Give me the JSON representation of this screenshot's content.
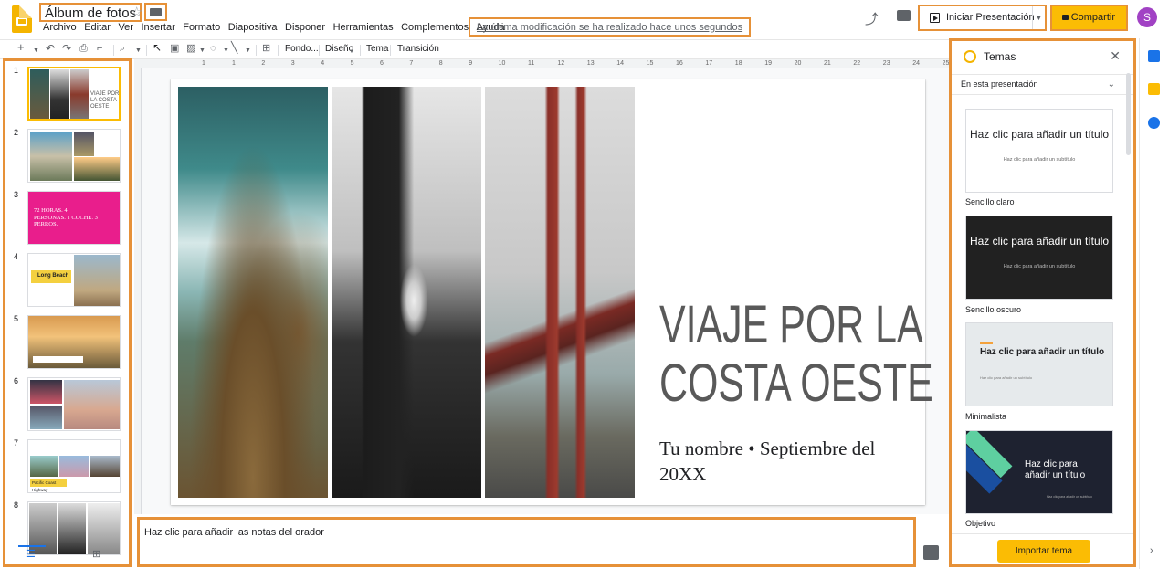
{
  "app": {
    "doc_title": "Álbum de fotos",
    "menus": [
      "Archivo",
      "Editar",
      "Ver",
      "Insertar",
      "Formato",
      "Diapositiva",
      "Disponer",
      "Herramientas",
      "Complementos",
      "Ayuda"
    ],
    "last_modified": "La última modificación se ha realizado hace unos segundos",
    "present_label": "Iniciar Presentación",
    "share_label": "Compartir",
    "avatar_letter": "S"
  },
  "toolbar": {
    "background": "Fondo...",
    "layout": "Diseño",
    "theme": "Tema",
    "transition": "Transición"
  },
  "ruler": [
    "1",
    "1",
    "2",
    "3",
    "4",
    "5",
    "6",
    "7",
    "8",
    "9",
    "10",
    "11",
    "12",
    "13",
    "14",
    "15",
    "16",
    "17",
    "18",
    "19",
    "20",
    "21",
    "22",
    "23",
    "24",
    "25"
  ],
  "filmstrip": {
    "slides": [
      {
        "num": "1",
        "text": "VIAJE POR LA COSTA OESTE"
      },
      {
        "num": "2",
        "text": ""
      },
      {
        "num": "3",
        "text": "72 HORAS. 4 PERSONAS. 1 COCHE. 3 PERROS."
      },
      {
        "num": "4",
        "text": "Long Beach"
      },
      {
        "num": "5",
        "text": ""
      },
      {
        "num": "6",
        "text": ""
      },
      {
        "num": "7",
        "text": "Pacific Coast Highway"
      },
      {
        "num": "8",
        "text": ""
      }
    ]
  },
  "slide": {
    "title": "VIAJE POR LA COSTA OESTE",
    "subtitle": "Tu nombre • Septiembre del 20XX"
  },
  "notes": {
    "placeholder": "Haz clic para añadir las notas del orador"
  },
  "themes": {
    "title": "Temas",
    "section": "En esta presentación",
    "items": [
      {
        "name": "Sencillo claro",
        "preview_title": "Haz clic para añadir un título",
        "preview_sub": "Haz clic para añadir un subtítulo"
      },
      {
        "name": "Sencillo oscuro",
        "preview_title": "Haz clic para añadir un título",
        "preview_sub": "Haz clic para añadir un subtítulo"
      },
      {
        "name": "Minimalista",
        "preview_title": "Haz clic para añadir un título",
        "preview_sub": "Haz clic para añadir un subtítulo"
      },
      {
        "name": "Objetivo",
        "preview_title": "Haz clic para añadir un título",
        "preview_sub": "Haz clic para añadir un subtítulo"
      }
    ],
    "import_label": "Importar tema"
  },
  "colors": {
    "accent": "#fbbc04",
    "highlight": "#e69138",
    "avatar": "#a142c4",
    "slide3_bg": "#e91e8c"
  }
}
